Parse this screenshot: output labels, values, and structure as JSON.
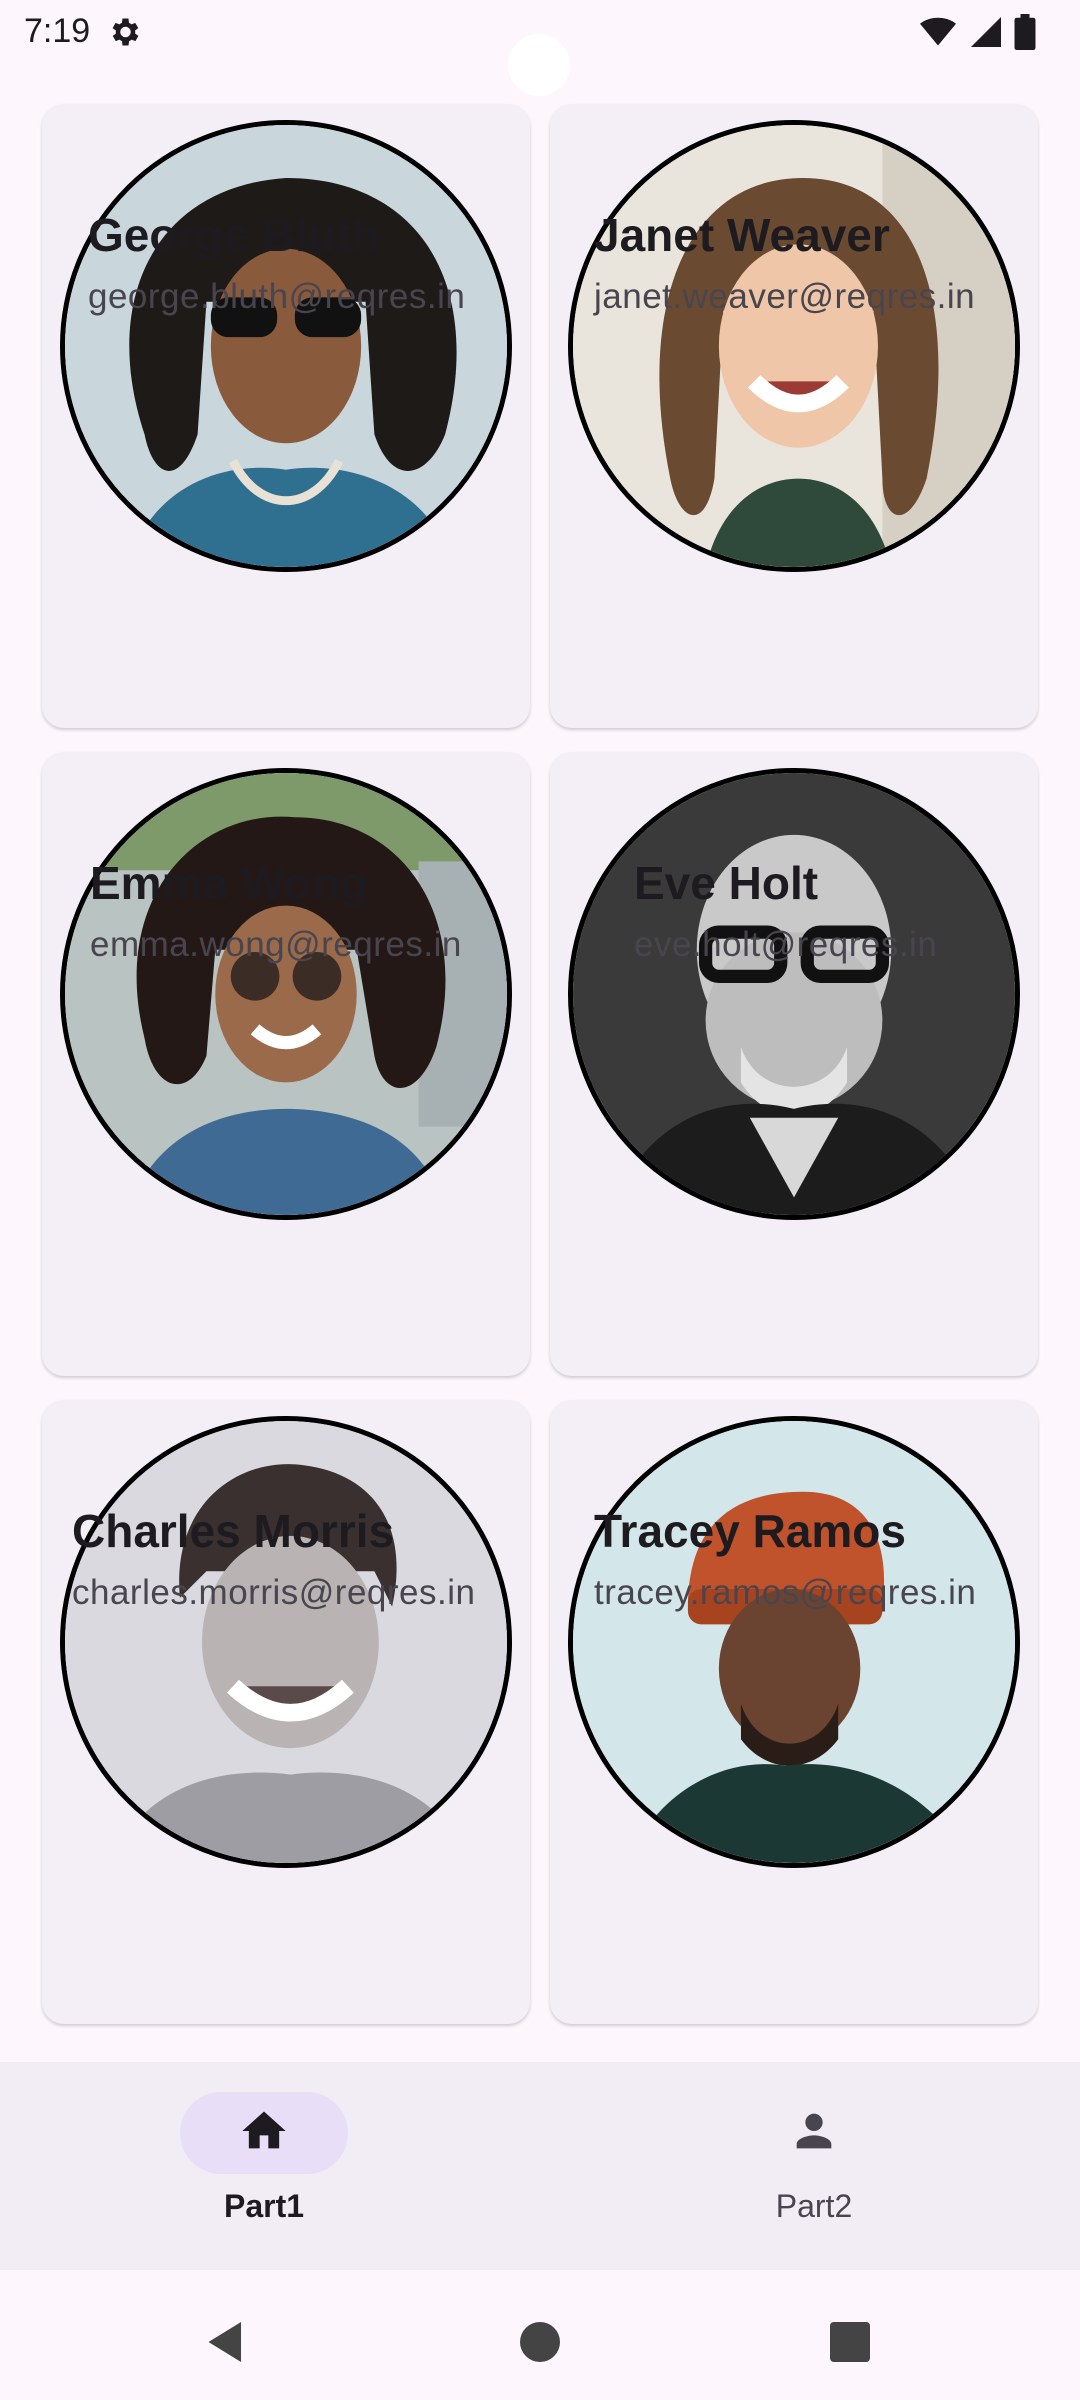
{
  "status": {
    "time": "7:19"
  },
  "users": [
    {
      "name": "George Bluth",
      "email": "george.bluth@reqres.in"
    },
    {
      "name": "Janet Weaver",
      "email": "janet.weaver@reqres.in"
    },
    {
      "name": "Emma Wong",
      "email": "emma.wong@reqres.in"
    },
    {
      "name": "Eve Holt",
      "email": "eve.holt@reqres.in"
    },
    {
      "name": "Charles Morris",
      "email": "charles.morris@reqres.in"
    },
    {
      "name": "Tracey Ramos",
      "email": "tracey.ramos@reqres.in"
    }
  ],
  "bottom_nav": {
    "items": [
      {
        "label": "Part1",
        "icon": "home-icon",
        "active": true
      },
      {
        "label": "Part2",
        "icon": "person-icon",
        "active": false
      }
    ]
  },
  "colors": {
    "background": "#fdf7fd",
    "card": "#f4eff6",
    "nav_bar": "#f2ecf4",
    "active_pill": "#e8def8",
    "text": "#1d1b20"
  }
}
